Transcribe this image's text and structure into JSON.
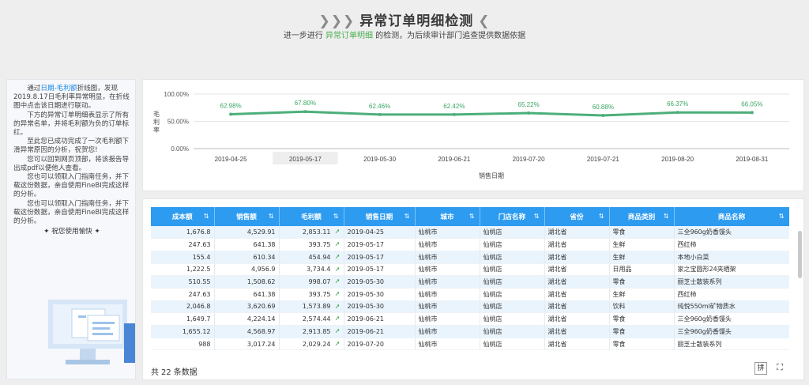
{
  "header": {
    "title": "异常订单明细检测",
    "chev_left": "❯❯❯",
    "chev_right": "❮",
    "subtitle_pre": "进一步进行 ",
    "subtitle_hl": "异常订单明细",
    "subtitle_post": " 的检测，为后续审计部门追查提供数据依据"
  },
  "left_panel": {
    "p1_pre": "通过",
    "p1_link": "日期-毛利额",
    "p1_post": "折线图，发现2019.8.17日毛利率异常明显，在折线图中点击该日期进行联动。",
    "p2": "下方的异常订单明细表显示了所有的异常名单，并将毛利额为负的订单标红。",
    "p3": "至此您已成功完成了一次毛利额下滑异常原因的分析，祝贺您!",
    "p4": "您可以回到网页顶部，将该报告导出成pdf以便他人查看。",
    "p5": "您也可以领取入门指南任务，并下载这份数据，亲自使用FineBI完成这样的分析。",
    "p6": "您也可以领取入门指南任务，并下载这份数据，亲自使用FineBI完成这样的分析。",
    "wish": "✦ 祝您使用愉快 ✦"
  },
  "chart_data": {
    "type": "line",
    "categories": [
      "2019-04-25",
      "2019-05-17",
      "2019-05-30",
      "2019-06-21",
      "2019-07-20",
      "2019-07-21",
      "2019-08-20",
      "2019-08-31"
    ],
    "values": [
      62.98,
      67.8,
      62.46,
      62.42,
      65.22,
      60.88,
      66.37,
      66.05
    ],
    "value_labels": [
      "62.98%",
      "67.80%",
      "62.46%",
      "62.42%",
      "65.22%",
      "60.88%",
      "66.37%",
      "66.05%"
    ],
    "ylabel": "毛利率",
    "xlabel": "销售日期",
    "ylim": [
      0,
      100
    ],
    "yticks": [
      "100.00%",
      "50.00%",
      "0.00%"
    ],
    "highlight_category": "2019-05-17",
    "line_color": "#4caf7a",
    "grid": true
  },
  "table": {
    "columns": [
      "成本额",
      "销售额",
      "毛利额",
      "销售日期",
      "城市",
      "门店名称",
      "省份",
      "商品类别",
      "商品名称"
    ],
    "sort_icon": "⇅",
    "rows": [
      [
        "1,676.8",
        "4,529.91",
        "2,853.11",
        "2019-04-25",
        "仙桃市",
        "仙桃店",
        "湖北省",
        "零食",
        "三全960g奶香馒头"
      ],
      [
        "247.63",
        "641.38",
        "393.75",
        "2019-05-17",
        "仙桃市",
        "仙桃店",
        "湖北省",
        "生鲜",
        "西红柿"
      ],
      [
        "155.4",
        "610.34",
        "454.94",
        "2019-05-17",
        "仙桃市",
        "仙桃店",
        "湖北省",
        "生鲜",
        "本地小白菜"
      ],
      [
        "1,222.5",
        "4,956.9",
        "3,734.4",
        "2019-05-17",
        "仙桃市",
        "仙桃店",
        "湖北省",
        "日用品",
        "家之宝圆形24夹晒架"
      ],
      [
        "510.55",
        "1,508.62",
        "998.07",
        "2019-05-30",
        "仙桃市",
        "仙桃店",
        "湖北省",
        "零食",
        "丽芝士散装系列"
      ],
      [
        "247.63",
        "641.38",
        "393.75",
        "2019-05-30",
        "仙桃市",
        "仙桃店",
        "湖北省",
        "生鲜",
        "西红柿"
      ],
      [
        "2,046.8",
        "3,620.69",
        "1,573.89",
        "2019-05-30",
        "仙桃市",
        "仙桃店",
        "湖北省",
        "饮料",
        "纯悦550ml矿物质水"
      ],
      [
        "1,649.7",
        "4,224.14",
        "2,574.44",
        "2019-06-21",
        "仙桃市",
        "仙桃店",
        "湖北省",
        "零食",
        "三全960g奶香馒头"
      ],
      [
        "1,655.12",
        "4,568.97",
        "2,913.85",
        "2019-06-21",
        "仙桃市",
        "仙桃店",
        "湖北省",
        "零食",
        "三全960g奶香馒头"
      ],
      [
        "988",
        "3,017.24",
        "2,029.24",
        "2019-07-20",
        "仙桃市",
        "仙桃店",
        "湖北省",
        "零食",
        "丽芝士散装系列"
      ]
    ],
    "up_arrow": "➚"
  },
  "footer": {
    "pre": "共",
    "count": "22",
    "post": "条数据",
    "tool_pinyin": "拼",
    "tool_expand": "⛶"
  }
}
